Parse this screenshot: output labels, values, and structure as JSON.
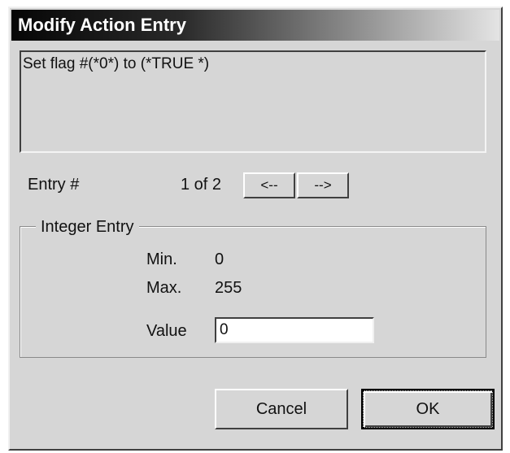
{
  "window": {
    "title": "Modify Action Entry"
  },
  "description": "Set flag #(*0*) to (*TRUE *)",
  "entry": {
    "label": "Entry #",
    "position": "1 of 2",
    "prev_label": "<--",
    "next_label": "-->"
  },
  "integer_entry": {
    "group_label": "Integer Entry",
    "min_label": "Min.",
    "min_value": "0",
    "max_label": "Max.",
    "max_value": "255",
    "value_label": "Value",
    "value": "0"
  },
  "buttons": {
    "cancel": "Cancel",
    "ok": "OK"
  }
}
